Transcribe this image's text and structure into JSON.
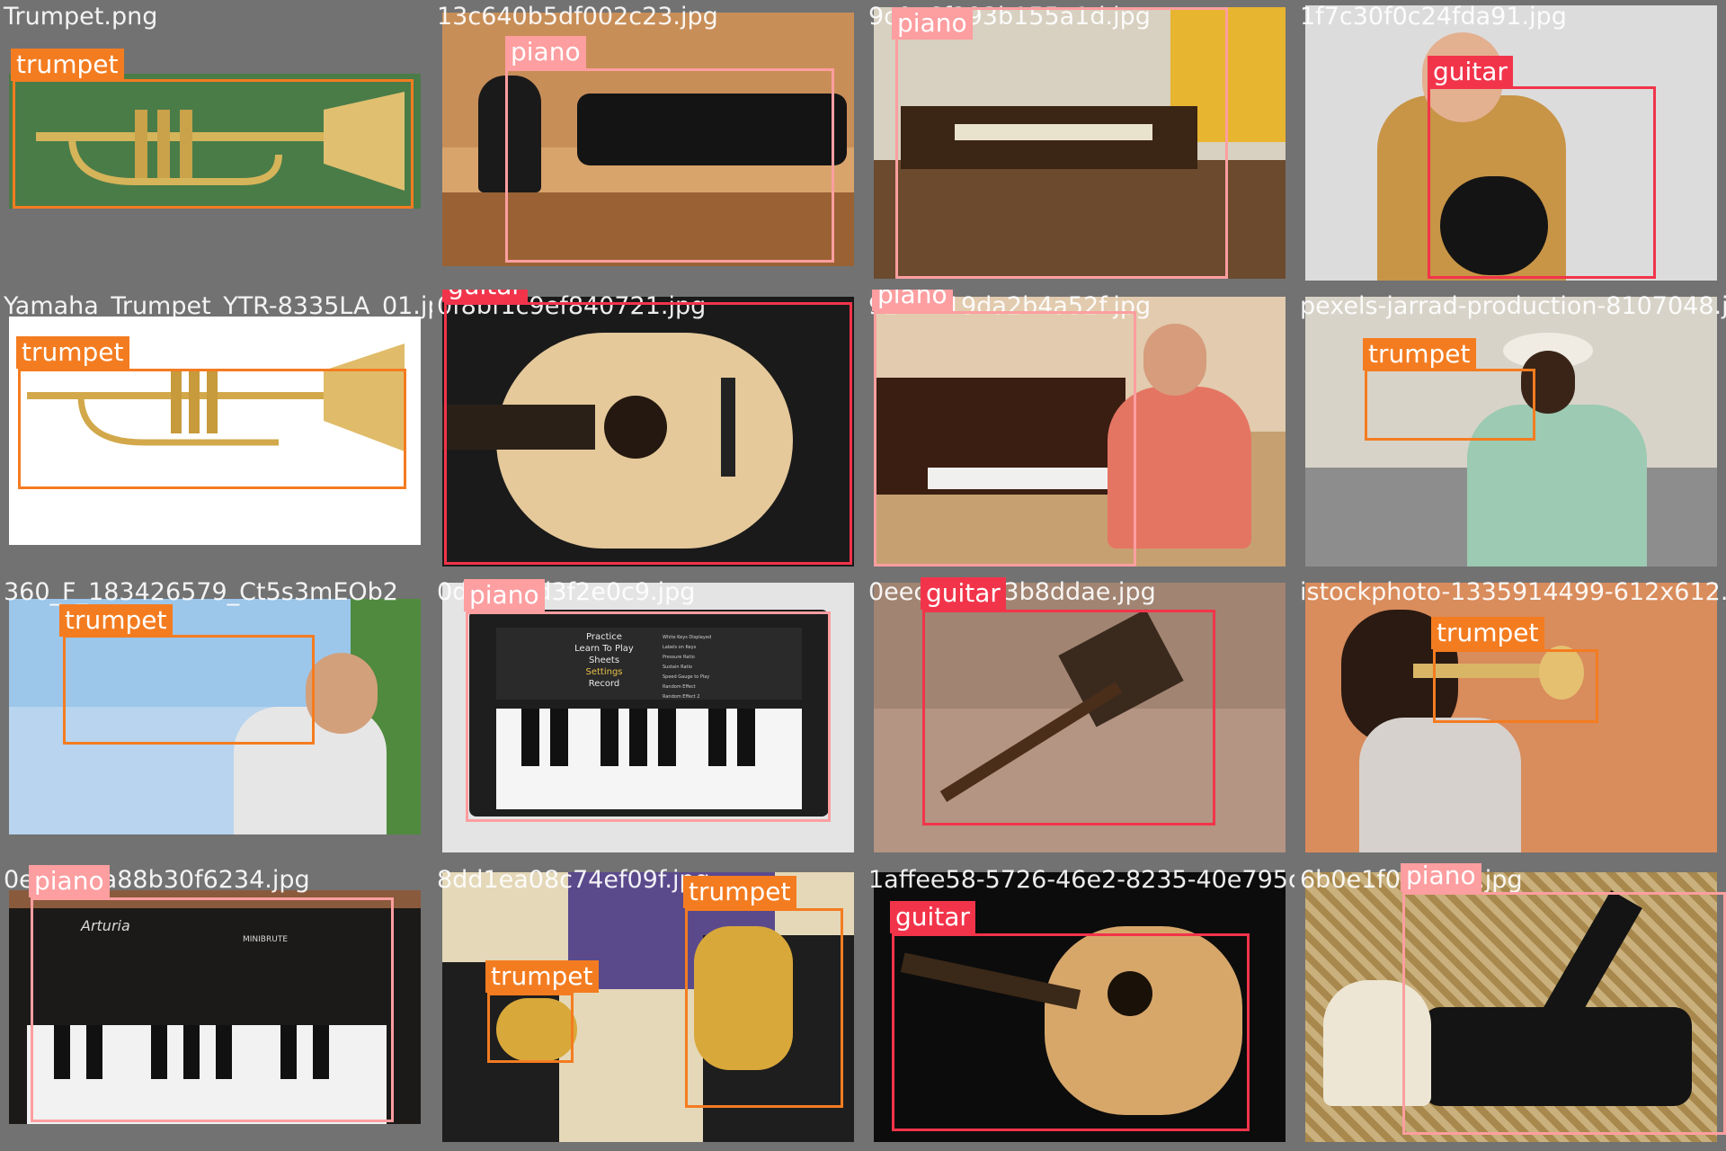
{
  "colors": {
    "trumpet": "#f47c20",
    "piano": "#fd9ea0",
    "guitar": "#f2344a",
    "grid_bg": "#727272"
  },
  "tiles": [
    {
      "filename": "Trumpet.png",
      "detections": [
        {
          "label": "trumpet"
        }
      ]
    },
    {
      "filename": "13c640b5df002c23.jpg",
      "detections": [
        {
          "label": "piano"
        }
      ]
    },
    {
      "filename": "9c0a6f293b155a1d.jpg",
      "detections": [
        {
          "label": "piano"
        }
      ]
    },
    {
      "filename": "1f7c30f0c24fda91.jpg",
      "detections": [
        {
          "label": "guitar"
        }
      ]
    },
    {
      "filename": "Yamaha_Trumpet_YTR-8335LA_01.jpg",
      "detections": [
        {
          "label": "trumpet"
        }
      ]
    },
    {
      "filename": "0f8bf1c9ef840721.jpg",
      "detections": [
        {
          "label": "guitar"
        }
      ]
    },
    {
      "filename": "924d119da2b4a52f.jpg",
      "detections": [
        {
          "label": "piano"
        }
      ]
    },
    {
      "filename": "pexels-jarrad-production-8107048.jpg",
      "detections": [
        {
          "label": "trumpet"
        }
      ]
    },
    {
      "filename": "360_F_183426579_Ct5s3mEOb2",
      "detections": [
        {
          "label": "trumpet"
        }
      ]
    },
    {
      "filename": "0d4f7c1d3f2e0c9.jpg",
      "detections": [
        {
          "label": "piano"
        }
      ]
    },
    {
      "filename": "0eecd8a3d3b8ddae.jpg",
      "detections": [
        {
          "label": "guitar"
        }
      ]
    },
    {
      "filename": "istockphoto-1335914499-612x612.jpg",
      "detections": [
        {
          "label": "trumpet"
        }
      ]
    },
    {
      "filename": "0e3c1f7a88b30f6234.jpg",
      "detections": [
        {
          "label": "piano"
        }
      ]
    },
    {
      "filename": "8dd1ea08c74ef09f.jpg",
      "detections": [
        {
          "label": "trumpet"
        },
        {
          "label": "trumpet"
        }
      ]
    },
    {
      "filename": "1affee58-5726-46e2-8235-40e795dd0d1e.jpg",
      "detections": [
        {
          "label": "guitar"
        }
      ]
    },
    {
      "filename": "6b0e1f0a5424.jpg",
      "detections": [
        {
          "label": "piano"
        }
      ]
    }
  ],
  "app_screen": {
    "menu": [
      "Practice",
      "Learn To Play",
      "Sheets",
      "Settings",
      "Record"
    ],
    "settings": [
      "White Keys Displayed",
      "Labels on Keys",
      "Pressure Ratio",
      "Sustain Ratio",
      "Speed Gauge to Play",
      "Random Effect",
      "Random Effect 2"
    ]
  },
  "synth": {
    "brand": "Arturia",
    "model": "MINIBRUTE"
  }
}
